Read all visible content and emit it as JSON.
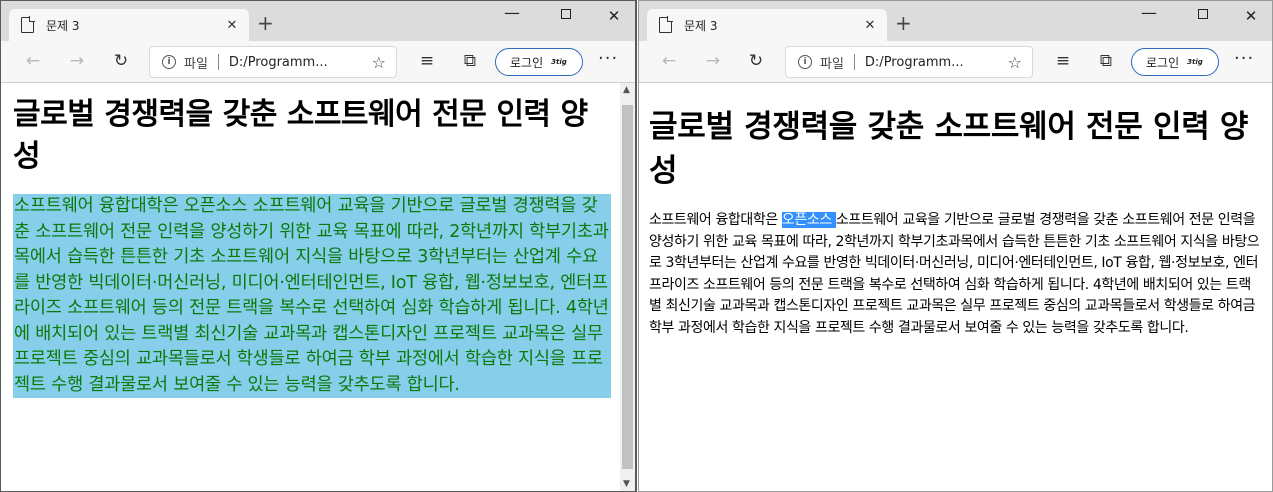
{
  "windows": [
    {
      "tab_title": "문제 3",
      "address_label": "파일",
      "address_url": "D:/Programm...",
      "login_label": "로그인",
      "avatar_text": "3tig",
      "heading": "글로벌 경쟁력을 갖춘 소프트웨어 전문 인력 양성",
      "paragraph": "소프트웨어 융합대학은 오픈소스 소프트웨어 교육을 기반으로 글로벌 경쟁력을 갖춘 소프트웨어 전문 인력을 양성하기 위한 교육 목표에 따라, 2학년까지 학부기초과목에서 습득한 튼튼한 기초 소프트웨어 지식을 바탕으로 3학년부터는 산업계 수요를 반영한 빅데이터·머신러닝, 미디어·엔터테인먼트, IoT 융합, 웹·정보보호, 엔터프라이즈 소프트웨어 등의 전문 트랙을 복수로 선택하여 심화 학습하게 됩니다. 4학년에 배치되어 있는 트랙별 최신기술 교과목과 캡스톤디자인 프로젝트 교과목은 실무 프로젝트 중심의 교과목들로서 학생들로 하여금 학부 과정에서 학습한 지식을 프로젝트 수행 결과물로서 보여줄 수 있는 능력을 갖추도록 합니다.",
      "paragraph_bg": "#87ceeb",
      "paragraph_color": "#0b7a0b"
    },
    {
      "tab_title": "문제 3",
      "address_label": "파일",
      "address_url": "D:/Programm...",
      "login_label": "로그인",
      "avatar_text": "3tig",
      "heading": "글로벌 경쟁력을 갖춘 소프트웨어 전문 인력 양성",
      "paragraph_pre": "소프트웨어 융합대학은 ",
      "paragraph_highlight": "오픈소스 ",
      "paragraph_post": "소프트웨어 교육을 기반으로 글로벌 경쟁력을 갖춘 소프트웨어 전문 인력을 양성하기 위한 교육 목표에 따라, 2학년까지 학부기초과목에서 습득한 튼튼한 기초 소프트웨어 지식을 바탕으로 3학년부터는 산업계 수요를 반영한 빅데이터·머신러닝, 미디어·엔터테인먼트, IoT 융합, 웹·정보보호, 엔터프라이즈 소프트웨어 등의 전문 트랙을 복수로 선택하여 심화 학습하게 됩니다. 4학년에 배치되어 있는 트랙별 최신기술 교과목과 캡스톤디자인 프로젝트 교과목은 실무 프로젝트 중심의 교과목들로서 학생들로 하여금 학부 과정에서 학습한 지식을 프로젝트 수행 결과물로서 보여줄 수 있는 능력을 갖추도록 합니다."
    }
  ],
  "icons": {
    "back": "←",
    "forward": "→",
    "refresh": "↻",
    "favorite": "☆",
    "favorites_bar": "≡",
    "collections": "⧉",
    "more": "···",
    "close": "✕",
    "new_tab": "+"
  }
}
